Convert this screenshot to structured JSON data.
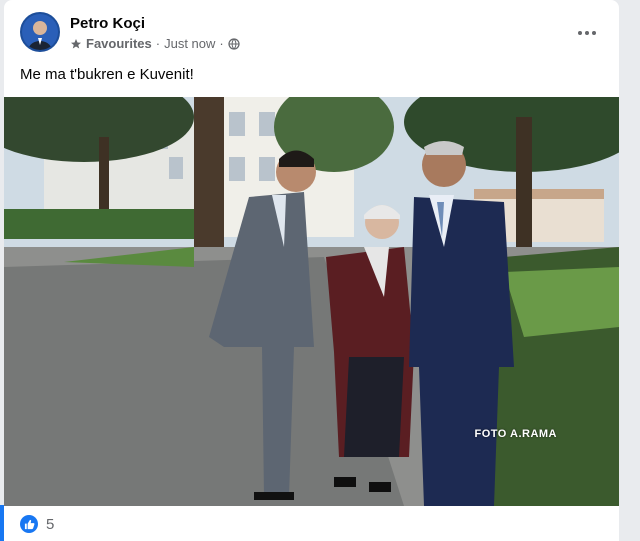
{
  "post": {
    "author": "Petro Koçi",
    "audience": "Favourites",
    "separator": "·",
    "timestamp": "Just now",
    "caption": "Me ma t'bukren e Kuvenit!",
    "photo_credit": "FOTO A.RAMA",
    "reaction_count": "5"
  },
  "colors": {
    "accent": "#1877f2",
    "text": "#050505",
    "secondary": "#65676b"
  },
  "icons": {
    "more": "more-options-icon",
    "star": "star-icon",
    "globe": "globe-icon",
    "like": "like-icon"
  }
}
